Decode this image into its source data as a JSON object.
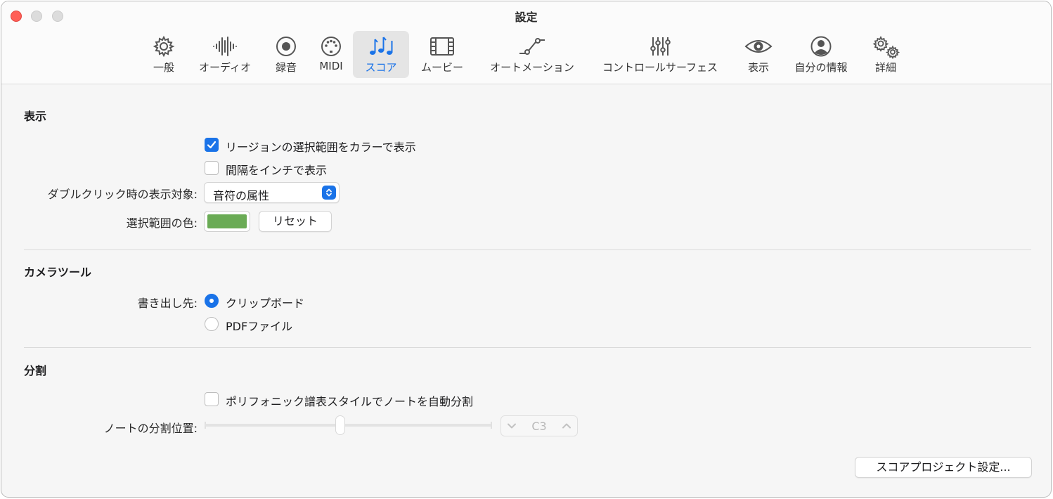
{
  "window": {
    "title": "設定"
  },
  "tabs": [
    {
      "id": "general",
      "label": "一般",
      "icon": "gear-icon"
    },
    {
      "id": "audio",
      "label": "オーディオ",
      "icon": "waveform-icon"
    },
    {
      "id": "record",
      "label": "録音",
      "icon": "record-icon"
    },
    {
      "id": "midi",
      "label": "MIDI",
      "icon": "midi-port-icon"
    },
    {
      "id": "score",
      "label": "スコア",
      "icon": "music-notes-icon",
      "active": true
    },
    {
      "id": "movie",
      "label": "ムービー",
      "icon": "film-icon"
    },
    {
      "id": "automation",
      "label": "オートメーション",
      "icon": "automation-curve-icon"
    },
    {
      "id": "control_surface",
      "label": "コントロールサーフェス",
      "icon": "sliders-icon"
    },
    {
      "id": "display",
      "label": "表示",
      "icon": "eye-icon"
    },
    {
      "id": "my_info",
      "label": "自分の情報",
      "icon": "person-circle-icon"
    },
    {
      "id": "advanced",
      "label": "詳細",
      "icon": "gears-icon"
    }
  ],
  "display_section": {
    "title": "表示",
    "color_region_selection": {
      "label": "リージョンの選択範囲をカラーで表示",
      "checked": true
    },
    "spacing_inches": {
      "label": "間隔をインチで表示",
      "checked": false
    },
    "double_click": {
      "label": "ダブルクリック時の表示対象:",
      "value": "音符の属性"
    },
    "selection_color": {
      "label": "選択範囲の色:",
      "color": "#6aab55",
      "reset_label": "リセット"
    }
  },
  "camera_section": {
    "title": "カメラツール",
    "export_label": "書き出し先:",
    "options": [
      {
        "label": "クリップボード",
        "selected": true
      },
      {
        "label": "PDFファイル",
        "selected": false
      }
    ]
  },
  "split_section": {
    "title": "分割",
    "auto_split": {
      "label": "ポリフォニック譜表スタイルでノートを自動分割",
      "checked": false
    },
    "split_point": {
      "label": "ノートの分割位置:",
      "value": "C3",
      "slider_fraction": 0.47
    }
  },
  "footer": {
    "project_settings_label": "スコアプロジェクト設定..."
  },
  "colors": {
    "accent": "#1a73e8",
    "selection_green": "#6aab55",
    "close_red": "#ff5f57"
  }
}
